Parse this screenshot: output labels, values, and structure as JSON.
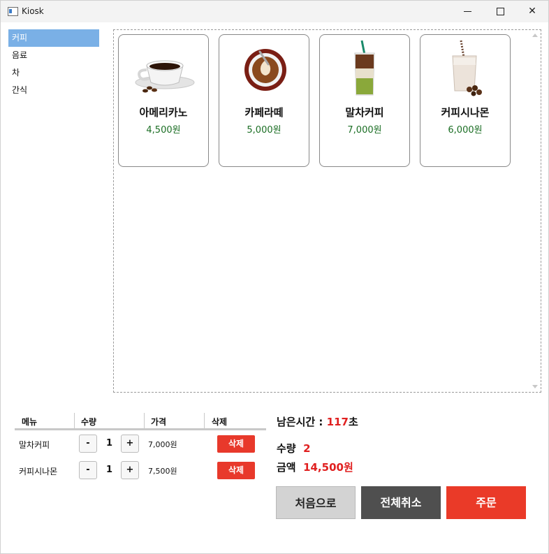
{
  "window": {
    "title": "Kiosk"
  },
  "categories": [
    "커피",
    "음료",
    "차",
    "간식"
  ],
  "menu_items": [
    {
      "name": "아메리카노",
      "price": "4,500원",
      "icon": "americano-cup-icon"
    },
    {
      "name": "카페라떼",
      "price": "5,000원",
      "icon": "latte-cup-icon"
    },
    {
      "name": "말차커피",
      "price": "7,000원",
      "icon": "matcha-coffee-glass-icon"
    },
    {
      "name": "커피시나몬",
      "price": "6,000원",
      "icon": "cinnamon-coffee-glass-icon"
    }
  ],
  "order_table": {
    "headers": {
      "menu": "메뉴",
      "qty": "수량",
      "price": "가격",
      "delete": "삭제"
    },
    "rows": [
      {
        "name": "말차커피",
        "minus": "-",
        "qty": "1",
        "plus": "+",
        "price": "7,000원",
        "delete": "삭제"
      },
      {
        "name": "커피시나몬",
        "minus": "-",
        "qty": "1",
        "plus": "+",
        "price": "7,500원",
        "delete": "삭제"
      }
    ]
  },
  "summary": {
    "time_label": "남은시간 :",
    "time_value": "117",
    "time_unit": "초",
    "qty_label": "수량",
    "qty_value": "2",
    "amount_label": "금액",
    "amount_value": "14,500원"
  },
  "actions": {
    "home": "처음으로",
    "cancel_all": "전체취소",
    "order": "주문"
  },
  "colors": {
    "selected_category": "#7ab0e6",
    "price_green": "#1b6e24",
    "accent_red": "#e8392b",
    "dark_button": "#4f4f4f"
  }
}
